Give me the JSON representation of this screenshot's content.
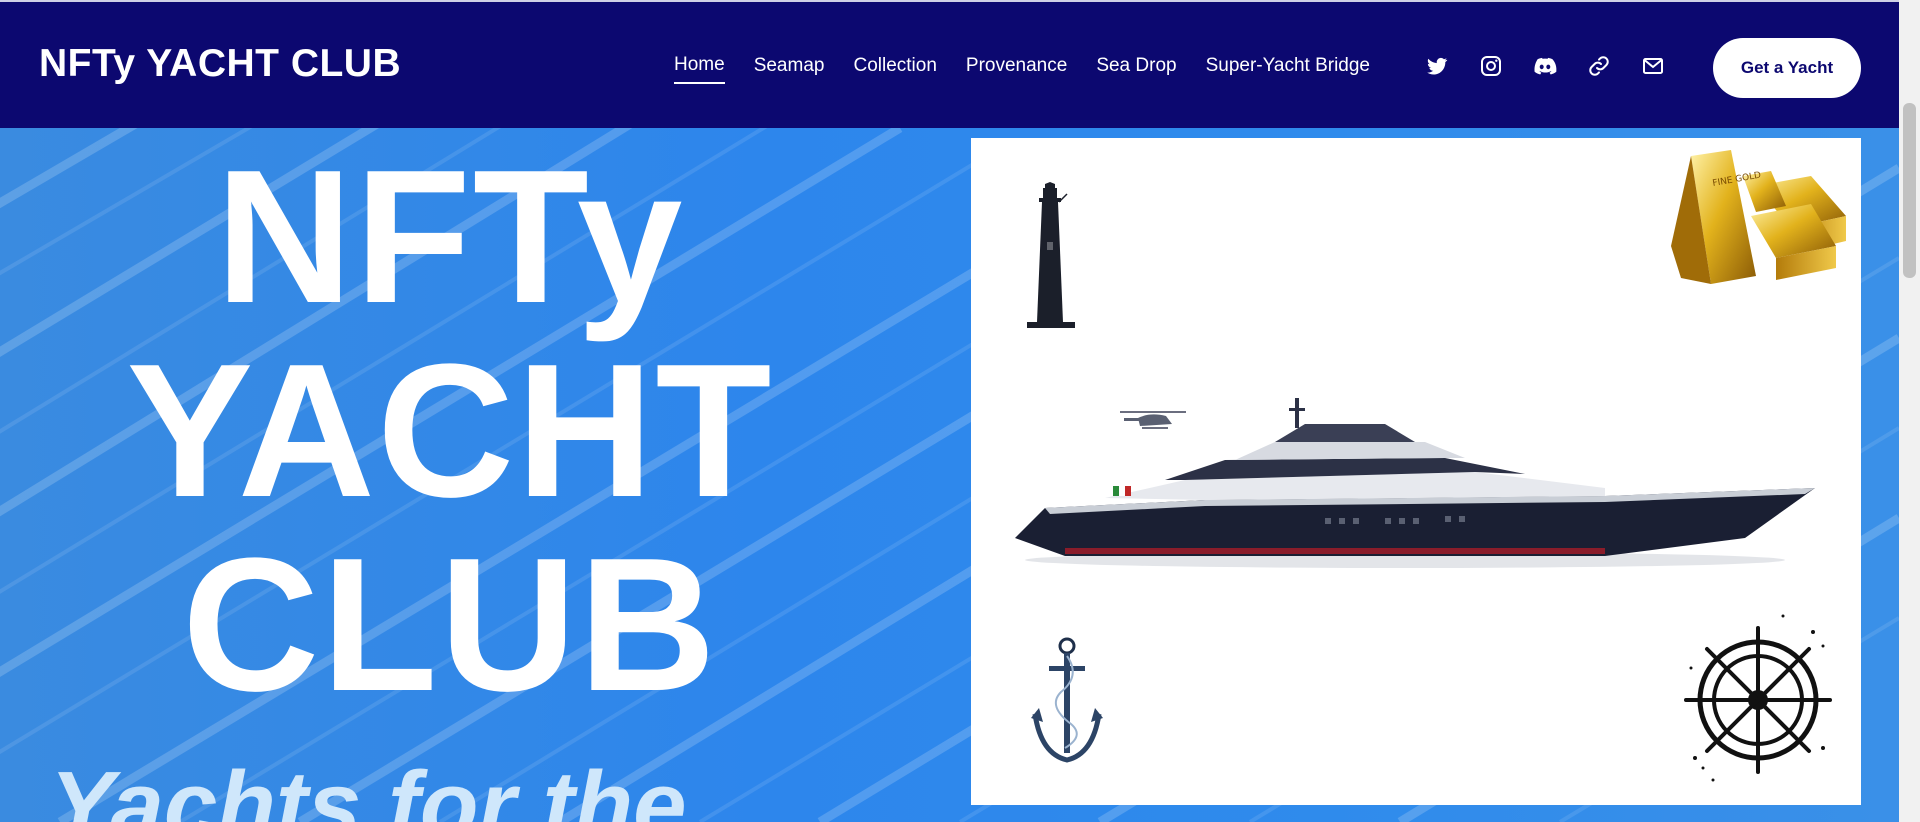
{
  "header": {
    "brand": "NFTy YACHT CLUB",
    "nav": [
      {
        "label": "Home",
        "active": true
      },
      {
        "label": "Seamap",
        "active": false
      },
      {
        "label": "Collection",
        "active": false
      },
      {
        "label": "Provenance",
        "active": false
      },
      {
        "label": "Sea Drop",
        "active": false
      },
      {
        "label": "Super-Yacht Bridge",
        "active": false
      }
    ],
    "social_icons": [
      "twitter-icon",
      "instagram-icon",
      "discord-icon",
      "link-icon",
      "mail-icon"
    ],
    "cta_label": "Get a Yacht"
  },
  "hero": {
    "title_lines": [
      "NFTy",
      "YACHT",
      "CLUB"
    ],
    "subtitle": "Yachts for the"
  },
  "showcase": {
    "images": [
      "lighthouse-image",
      "gold-bars-image",
      "superyacht-image",
      "anchor-image",
      "ships-wheel-image"
    ]
  },
  "colors": {
    "header_bg": "#0c0870",
    "hero_bg": "#2f86e6",
    "cta_text": "#0c0870",
    "subtitle": "#cfe7fb"
  }
}
